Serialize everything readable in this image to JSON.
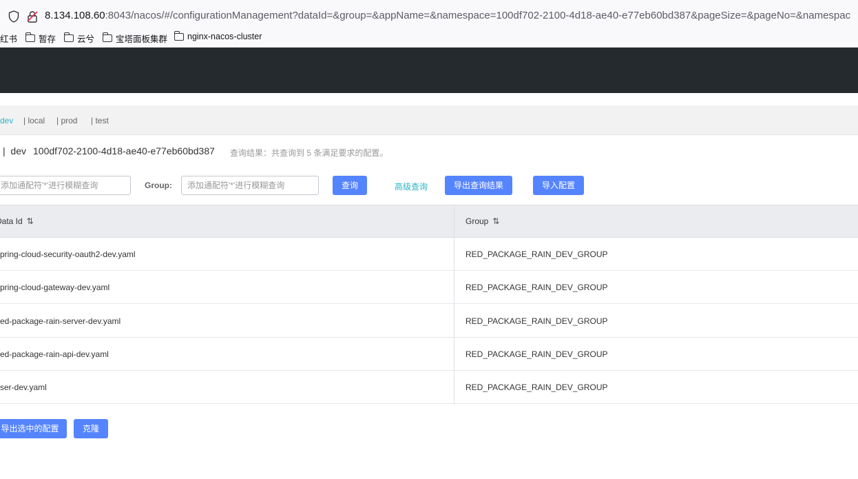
{
  "browser": {
    "url_host": "8.134.108.60",
    "url_rest": ":8043/nacos/#/configurationManagement?dataId=&group=&appName=&namespace=100df702-2100-4d18-ae40-e77eb60bd387&pageSize=&pageNo=&namespac",
    "bookmarks": [
      {
        "label": "红书",
        "folder": false
      },
      {
        "label": "暂存",
        "folder": true
      },
      {
        "label": "云兮",
        "folder": true
      },
      {
        "label": "宝塔面板集群",
        "folder": true
      },
      {
        "label": "nginx-nacos-cluster",
        "folder": true
      }
    ]
  },
  "namespaces": [
    {
      "label": "dev",
      "active": true
    },
    {
      "label": "| local",
      "active": false
    },
    {
      "label": "| prod",
      "active": false
    },
    {
      "label": "| test",
      "active": false
    }
  ],
  "title": {
    "main": "|  dev",
    "namespace_id": "100df702-2100-4d18-ae40-e77eb60bd387",
    "result_text": "查询结果：共查询到 5 条满足要求的配置。"
  },
  "search": {
    "dataid_placeholder": "添加通配符'*'进行模糊查询",
    "group_label": "Group:",
    "group_placeholder": "添加通配符'*'进行模糊查询",
    "query_button": "查询",
    "advanced_link": "高级查询",
    "export_results_button": "导出查询结果",
    "import_button": "导入配置"
  },
  "table": {
    "headers": [
      "Data Id",
      "Group"
    ],
    "rows": [
      {
        "data_id": "pring-cloud-security-oauth2-dev.yaml",
        "group": "RED_PACKAGE_RAIN_DEV_GROUP"
      },
      {
        "data_id": "pring-cloud-gateway-dev.yaml",
        "group": "RED_PACKAGE_RAIN_DEV_GROUP"
      },
      {
        "data_id": "ed-package-rain-server-dev.yaml",
        "group": "RED_PACKAGE_RAIN_DEV_GROUP"
      },
      {
        "data_id": "ed-package-rain-api-dev.yaml",
        "group": "RED_PACKAGE_RAIN_DEV_GROUP"
      },
      {
        "data_id": "ser-dev.yaml",
        "group": "RED_PACKAGE_RAIN_DEV_GROUP"
      }
    ]
  },
  "footer": {
    "export_selected_button": "导出选中的配置",
    "clone_button": "克隆"
  },
  "colors": {
    "header_bg": "#252a2f",
    "primary": "#5584ff",
    "accent": "#2ab4c8"
  }
}
